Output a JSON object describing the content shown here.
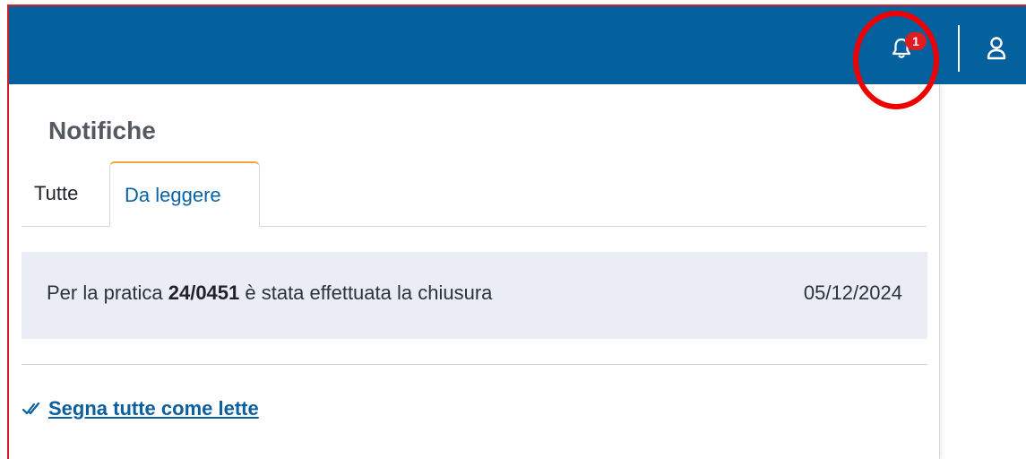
{
  "header": {
    "notifications_count": "1",
    "bar_color": "#05619e",
    "bell_icon": "bell-icon",
    "user_icon": "user-icon"
  },
  "panel": {
    "title": "Notifiche",
    "tabs": [
      {
        "label": "Tutte",
        "active": false
      },
      {
        "label": "Da leggere",
        "active": true
      }
    ],
    "notifications": [
      {
        "text_before": "Per la pratica ",
        "reference": "24/0451",
        "text_after": " è stata effettuata la chiusura",
        "date": "05/12/2024"
      }
    ],
    "mark_all_label": "Segna tutte come lette",
    "mark_all_icon": "double-check-icon"
  },
  "colors": {
    "accent": "#0b62a4",
    "badge": "#e11b22",
    "highlight_ring": "#ee0000",
    "active_tab_top": "#f0a640",
    "row_background": "#eaedf5"
  }
}
